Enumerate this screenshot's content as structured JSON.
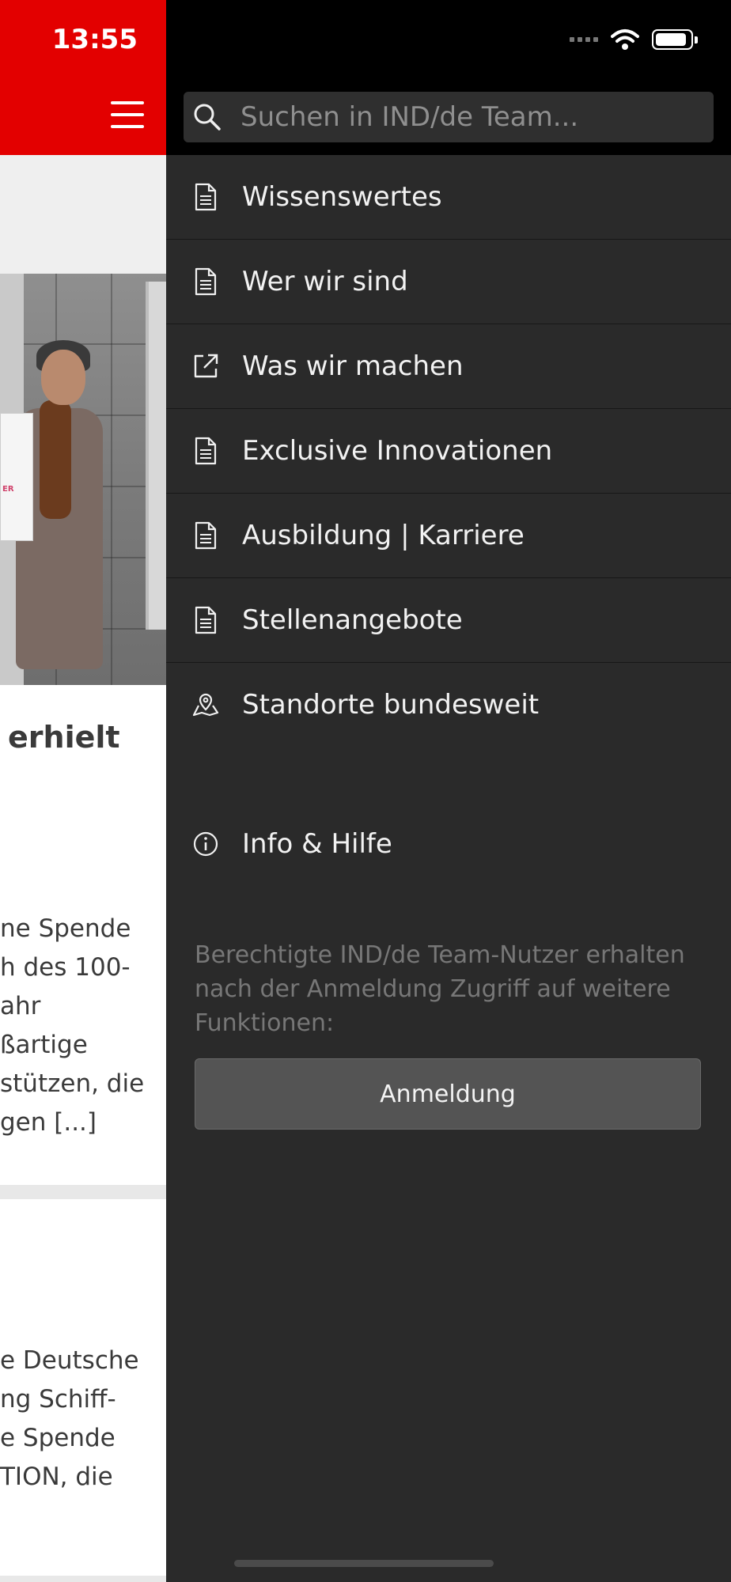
{
  "status_bar": {
    "time": "13:55"
  },
  "search": {
    "placeholder": "Suchen in IND/de Team..."
  },
  "menu": {
    "items": [
      {
        "label": "Wissenswertes",
        "icon": "document-icon"
      },
      {
        "label": "Wer wir sind",
        "icon": "document-icon"
      },
      {
        "label": "Was wir machen",
        "icon": "external-link-icon"
      },
      {
        "label": "Exclusive Innovationen",
        "icon": "document-icon"
      },
      {
        "label": "Ausbildung | Karriere",
        "icon": "document-icon"
      },
      {
        "label": "Stellenangebote",
        "icon": "document-icon"
      },
      {
        "label": "Standorte bundesweit",
        "icon": "map-pin-icon"
      }
    ],
    "info": {
      "label": "Info & Hilfe",
      "icon": "info-icon"
    }
  },
  "notice": "Berechtigte IND/de Team-Nutzer erhalten nach der Anmeldung Zugriff auf weitere Funktionen:",
  "login_button": "Anmeldung",
  "background_article": {
    "title_fragment": "erhielt",
    "certificate_fragment": "ER",
    "lines": [
      "ne Spende",
      "h des 100-",
      "ahr",
      "ßartige",
      "stützen, die",
      "gen [...]"
    ]
  },
  "background_article2": {
    "lines": [
      "e Deutsche",
      "ng Schiff-",
      "e Spende",
      "TION, die"
    ]
  },
  "colors": {
    "brand_red": "#e30000",
    "drawer_bg": "#2a2a2a",
    "header_bg": "#000000"
  }
}
